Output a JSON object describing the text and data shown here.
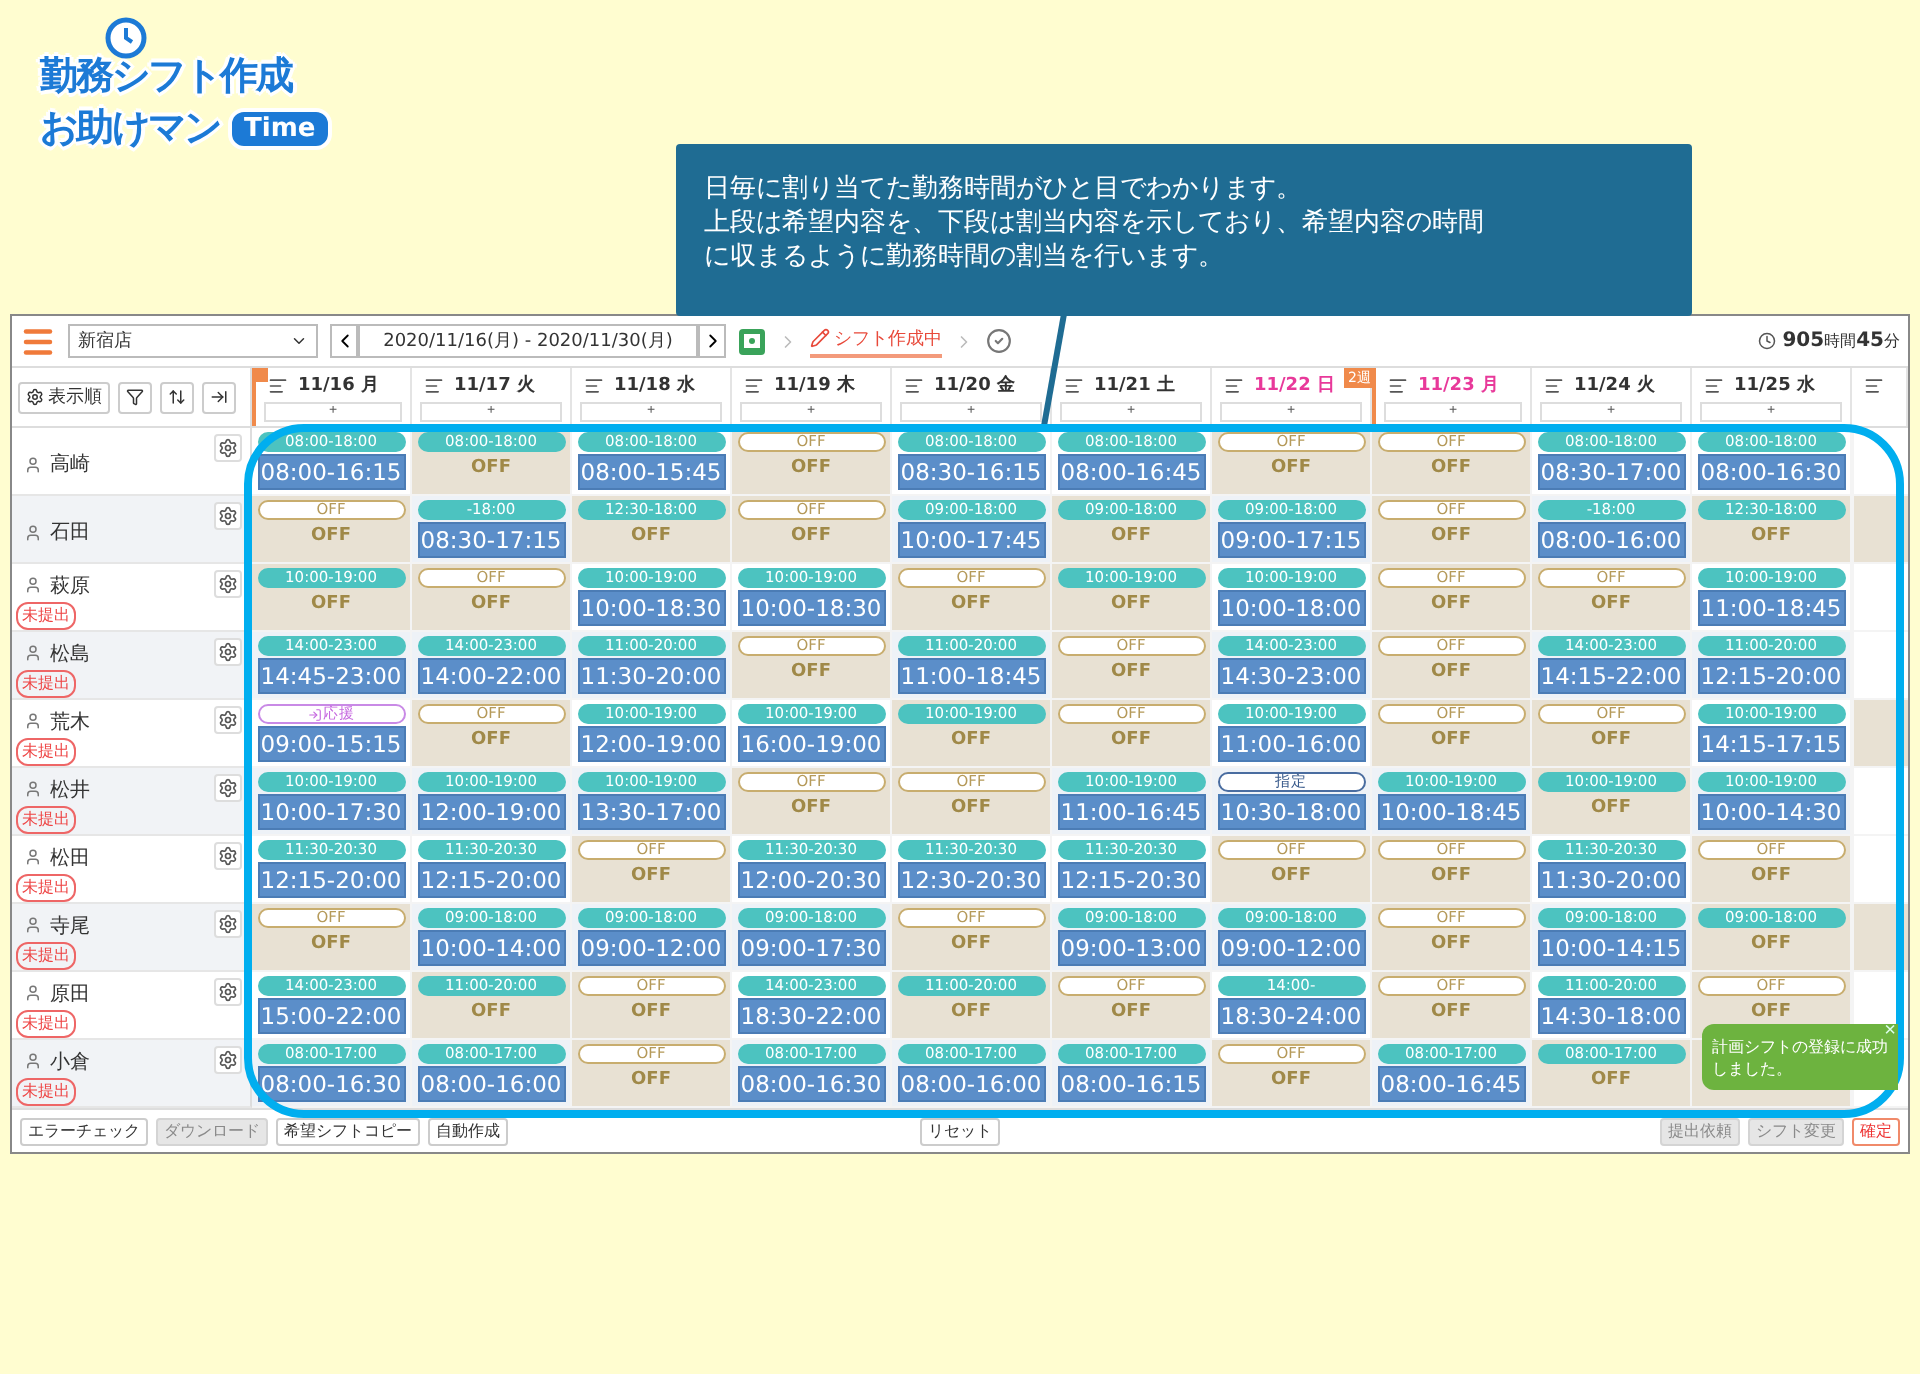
{
  "logo": {
    "line1": "勤務シフト作成",
    "line2": "お助けマン",
    "badge": "Time"
  },
  "callout": {
    "lines": [
      "日毎に割り当てた勤務時間がひと目でわかります。",
      "上段は希望内容を、下段は割当内容を示しており、希望内容の時間",
      "に収まるように勤務時間の割当を行います。"
    ]
  },
  "toolbar": {
    "store": "新宿店",
    "date_range": "2020/11/16(月) - 2020/11/30(月)",
    "status": "シフト作成中",
    "total": "**905**時間**45**分"
  },
  "header": {
    "sort_label": "表示順",
    "days": [
      {
        "label": "11/16 月",
        "holiday": false,
        "period_start": true,
        "add": "+"
      },
      {
        "label": "11/17 火",
        "holiday": false,
        "period_start": false,
        "add": "+"
      },
      {
        "label": "11/18 水",
        "holiday": false,
        "period_start": false,
        "add": "+"
      },
      {
        "label": "11/19 木",
        "holiday": false,
        "period_start": false,
        "add": "+"
      },
      {
        "label": "11/20 金",
        "holiday": false,
        "period_start": false,
        "add": "+"
      },
      {
        "label": "11/21 土",
        "holiday": false,
        "period_start": false,
        "add": "+"
      },
      {
        "label": "11/22 日",
        "holiday": true,
        "period_start": false,
        "add": "+"
      },
      {
        "label": "11/23 月",
        "holiday": true,
        "period_start": false,
        "week_label": "2週",
        "add": "+"
      },
      {
        "label": "11/24 火",
        "holiday": false,
        "period_start": false,
        "add": "+"
      },
      {
        "label": "11/25 水",
        "holiday": false,
        "period_start": false,
        "add": "+"
      }
    ]
  },
  "rows": [
    {
      "name": "高崎",
      "cells": [
        {
          "wish": {
            "kind": "time",
            "text": "08:00-18:00"
          },
          "shift": {
            "kind": "work",
            "text": "08:00-16:15"
          }
        },
        {
          "wish": {
            "kind": "time",
            "text": "08:00-18:00"
          },
          "shift": {
            "kind": "off",
            "text": "OFF"
          }
        },
        {
          "wish": {
            "kind": "time",
            "text": "08:00-18:00"
          },
          "shift": {
            "kind": "work",
            "text": "08:00-15:45"
          }
        },
        {
          "wish": {
            "kind": "off",
            "text": "OFF"
          },
          "shift": {
            "kind": "off",
            "text": "OFF"
          }
        },
        {
          "wish": {
            "kind": "time",
            "text": "08:00-18:00"
          },
          "shift": {
            "kind": "work",
            "text": "08:30-16:15"
          }
        },
        {
          "wish": {
            "kind": "time",
            "text": "08:00-18:00"
          },
          "shift": {
            "kind": "work",
            "text": "08:00-16:45"
          }
        },
        {
          "wish": {
            "kind": "off",
            "text": "OFF"
          },
          "shift": {
            "kind": "off",
            "text": "OFF"
          }
        },
        {
          "wish": {
            "kind": "off",
            "text": "OFF"
          },
          "shift": {
            "kind": "off",
            "text": "OFF"
          }
        },
        {
          "wish": {
            "kind": "time",
            "text": "08:00-18:00"
          },
          "shift": {
            "kind": "work",
            "text": "08:30-17:00"
          }
        },
        {
          "wish": {
            "kind": "time",
            "text": "08:00-18:00"
          },
          "shift": {
            "kind": "work",
            "text": "08:00-16:30"
          }
        }
      ]
    },
    {
      "name": "石田",
      "cells": [
        {
          "wish": {
            "kind": "off",
            "text": "OFF"
          },
          "shift": {
            "kind": "off",
            "text": "OFF"
          }
        },
        {
          "wish": {
            "kind": "time",
            "text": "-18:00"
          },
          "shift": {
            "kind": "work",
            "text": "08:30-17:15"
          }
        },
        {
          "wish": {
            "kind": "time",
            "text": "12:30-18:00"
          },
          "shift": {
            "kind": "off",
            "text": "OFF"
          }
        },
        {
          "wish": {
            "kind": "off",
            "text": "OFF"
          },
          "shift": {
            "kind": "off",
            "text": "OFF"
          }
        },
        {
          "wish": {
            "kind": "time",
            "text": "09:00-18:00"
          },
          "shift": {
            "kind": "work",
            "text": "10:00-17:45"
          }
        },
        {
          "wish": {
            "kind": "time",
            "text": "09:00-18:00"
          },
          "shift": {
            "kind": "off",
            "text": "OFF"
          }
        },
        {
          "wish": {
            "kind": "time",
            "text": "09:00-18:00"
          },
          "shift": {
            "kind": "work",
            "text": "09:00-17:15"
          }
        },
        {
          "wish": {
            "kind": "off",
            "text": "OFF"
          },
          "shift": {
            "kind": "off",
            "text": "OFF"
          }
        },
        {
          "wish": {
            "kind": "time",
            "text": "-18:00"
          },
          "shift": {
            "kind": "work",
            "text": "08:00-16:00"
          }
        },
        {
          "wish": {
            "kind": "time",
            "text": "12:30-18:00"
          },
          "shift": {
            "kind": "off",
            "text": "OFF"
          }
        }
      ]
    },
    {
      "name": "萩原",
      "badge": "未提出",
      "cells": [
        {
          "wish": {
            "kind": "time",
            "text": "10:00-19:00"
          },
          "shift": {
            "kind": "off",
            "text": "OFF"
          }
        },
        {
          "wish": {
            "kind": "off",
            "text": "OFF"
          },
          "shift": {
            "kind": "off",
            "text": "OFF"
          }
        },
        {
          "wish": {
            "kind": "time",
            "text": "10:00-19:00"
          },
          "shift": {
            "kind": "work",
            "text": "10:00-18:30"
          }
        },
        {
          "wish": {
            "kind": "time",
            "text": "10:00-19:00"
          },
          "shift": {
            "kind": "work",
            "text": "10:00-18:30"
          }
        },
        {
          "wish": {
            "kind": "off",
            "text": "OFF"
          },
          "shift": {
            "kind": "off",
            "text": "OFF"
          }
        },
        {
          "wish": {
            "kind": "time",
            "text": "10:00-19:00"
          },
          "shift": {
            "kind": "off",
            "text": "OFF"
          }
        },
        {
          "wish": {
            "kind": "time",
            "text": "10:00-19:00"
          },
          "shift": {
            "kind": "work",
            "text": "10:00-18:00"
          }
        },
        {
          "wish": {
            "kind": "off",
            "text": "OFF"
          },
          "shift": {
            "kind": "off",
            "text": "OFF"
          }
        },
        {
          "wish": {
            "kind": "off",
            "text": "OFF"
          },
          "shift": {
            "kind": "off",
            "text": "OFF"
          }
        },
        {
          "wish": {
            "kind": "time",
            "text": "10:00-19:00"
          },
          "shift": {
            "kind": "work",
            "text": "11:00-18:45"
          }
        }
      ]
    },
    {
      "name": "松島",
      "badge": "未提出",
      "cells": [
        {
          "wish": {
            "kind": "time",
            "text": "14:00-23:00"
          },
          "shift": {
            "kind": "work",
            "text": "14:45-23:00"
          }
        },
        {
          "wish": {
            "kind": "time",
            "text": "14:00-23:00"
          },
          "shift": {
            "kind": "work",
            "text": "14:00-22:00"
          }
        },
        {
          "wish": {
            "kind": "time",
            "text": "11:00-20:00"
          },
          "shift": {
            "kind": "work",
            "text": "11:30-20:00"
          }
        },
        {
          "wish": {
            "kind": "off",
            "text": "OFF"
          },
          "shift": {
            "kind": "off",
            "text": "OFF"
          }
        },
        {
          "wish": {
            "kind": "time",
            "text": "11:00-20:00"
          },
          "shift": {
            "kind": "work",
            "text": "11:00-18:45"
          }
        },
        {
          "wish": {
            "kind": "off",
            "text": "OFF"
          },
          "shift": {
            "kind": "off",
            "text": "OFF"
          }
        },
        {
          "wish": {
            "kind": "time",
            "text": "14:00-23:00"
          },
          "shift": {
            "kind": "work",
            "text": "14:30-23:00"
          }
        },
        {
          "wish": {
            "kind": "off",
            "text": "OFF"
          },
          "shift": {
            "kind": "off",
            "text": "OFF"
          }
        },
        {
          "wish": {
            "kind": "time",
            "text": "14:00-23:00"
          },
          "shift": {
            "kind": "work",
            "text": "14:15-22:00"
          }
        },
        {
          "wish": {
            "kind": "time",
            "text": "11:00-20:00"
          },
          "shift": {
            "kind": "work",
            "text": "12:15-20:00"
          }
        }
      ]
    },
    {
      "name": "荒木",
      "badge": "未提出",
      "cells": [
        {
          "wish": {
            "kind": "support",
            "text": "応援"
          },
          "shift": {
            "kind": "work",
            "text": "09:00-15:15"
          }
        },
        {
          "wish": {
            "kind": "off",
            "text": "OFF"
          },
          "shift": {
            "kind": "off",
            "text": "OFF"
          }
        },
        {
          "wish": {
            "kind": "time",
            "text": "10:00-19:00"
          },
          "shift": {
            "kind": "work",
            "text": "12:00-19:00"
          }
        },
        {
          "wish": {
            "kind": "time",
            "text": "10:00-19:00"
          },
          "shift": {
            "kind": "work",
            "text": "16:00-19:00"
          }
        },
        {
          "wish": {
            "kind": "time",
            "text": "10:00-19:00"
          },
          "shift": {
            "kind": "off",
            "text": "OFF"
          }
        },
        {
          "wish": {
            "kind": "off",
            "text": "OFF"
          },
          "shift": {
            "kind": "off",
            "text": "OFF"
          }
        },
        {
          "wish": {
            "kind": "time",
            "text": "10:00-19:00"
          },
          "shift": {
            "kind": "work",
            "text": "11:00-16:00"
          }
        },
        {
          "wish": {
            "kind": "off",
            "text": "OFF"
          },
          "shift": {
            "kind": "off",
            "text": "OFF"
          }
        },
        {
          "wish": {
            "kind": "off",
            "text": "OFF"
          },
          "shift": {
            "kind": "off",
            "text": "OFF"
          }
        },
        {
          "wish": {
            "kind": "time",
            "text": "10:00-19:00"
          },
          "shift": {
            "kind": "work",
            "text": "14:15-17:15"
          }
        }
      ]
    },
    {
      "name": "松井",
      "badge": "未提出",
      "cells": [
        {
          "wish": {
            "kind": "time",
            "text": "10:00-19:00"
          },
          "shift": {
            "kind": "work",
            "text": "10:00-17:30"
          }
        },
        {
          "wish": {
            "kind": "time",
            "text": "10:00-19:00"
          },
          "shift": {
            "kind": "work",
            "text": "12:00-19:00"
          }
        },
        {
          "wish": {
            "kind": "time",
            "text": "10:00-19:00"
          },
          "shift": {
            "kind": "work",
            "text": "13:30-17:00"
          }
        },
        {
          "wish": {
            "kind": "off",
            "text": "OFF"
          },
          "shift": {
            "kind": "off",
            "text": "OFF"
          }
        },
        {
          "wish": {
            "kind": "off",
            "text": "OFF"
          },
          "shift": {
            "kind": "off",
            "text": "OFF"
          }
        },
        {
          "wish": {
            "kind": "time",
            "text": "10:00-19:00"
          },
          "shift": {
            "kind": "work",
            "text": "11:00-16:45"
          }
        },
        {
          "wish": {
            "kind": "fixed",
            "text": "指定"
          },
          "shift": {
            "kind": "work",
            "text": "10:30-18:00"
          }
        },
        {
          "wish": {
            "kind": "time",
            "text": "10:00-19:00"
          },
          "shift": {
            "kind": "work",
            "text": "10:00-18:45"
          }
        },
        {
          "wish": {
            "kind": "time",
            "text": "10:00-19:00"
          },
          "shift": {
            "kind": "off",
            "text": "OFF"
          }
        },
        {
          "wish": {
            "kind": "time",
            "text": "10:00-19:00"
          },
          "shift": {
            "kind": "work",
            "text": "10:00-14:30"
          }
        }
      ]
    },
    {
      "name": "松田",
      "badge": "未提出",
      "cells": [
        {
          "wish": {
            "kind": "time",
            "text": "11:30-20:30"
          },
          "shift": {
            "kind": "work",
            "text": "12:15-20:00"
          }
        },
        {
          "wish": {
            "kind": "time",
            "text": "11:30-20:30"
          },
          "shift": {
            "kind": "work",
            "text": "12:15-20:00"
          }
        },
        {
          "wish": {
            "kind": "off",
            "text": "OFF"
          },
          "shift": {
            "kind": "off",
            "text": "OFF"
          }
        },
        {
          "wish": {
            "kind": "time",
            "text": "11:30-20:30"
          },
          "shift": {
            "kind": "work",
            "text": "12:00-20:30"
          }
        },
        {
          "wish": {
            "kind": "time",
            "text": "11:30-20:30"
          },
          "shift": {
            "kind": "work",
            "text": "12:30-20:30"
          }
        },
        {
          "wish": {
            "kind": "time",
            "text": "11:30-20:30"
          },
          "shift": {
            "kind": "work",
            "text": "12:15-20:30"
          }
        },
        {
          "wish": {
            "kind": "off",
            "text": "OFF"
          },
          "shift": {
            "kind": "off",
            "text": "OFF"
          }
        },
        {
          "wish": {
            "kind": "off",
            "text": "OFF"
          },
          "shift": {
            "kind": "off",
            "text": "OFF"
          }
        },
        {
          "wish": {
            "kind": "time",
            "text": "11:30-20:30"
          },
          "shift": {
            "kind": "work",
            "text": "11:30-20:00"
          }
        },
        {
          "wish": {
            "kind": "off",
            "text": "OFF"
          },
          "shift": {
            "kind": "off",
            "text": "OFF"
          }
        }
      ]
    },
    {
      "name": "寺尾",
      "badge": "未提出",
      "cells": [
        {
          "wish": {
            "kind": "off",
            "text": "OFF"
          },
          "shift": {
            "kind": "off",
            "text": "OFF"
          }
        },
        {
          "wish": {
            "kind": "time",
            "text": "09:00-18:00"
          },
          "shift": {
            "kind": "work",
            "text": "10:00-14:00"
          }
        },
        {
          "wish": {
            "kind": "time",
            "text": "09:00-18:00"
          },
          "shift": {
            "kind": "work",
            "text": "09:00-12:00"
          }
        },
        {
          "wish": {
            "kind": "time",
            "text": "09:00-18:00"
          },
          "shift": {
            "kind": "work",
            "text": "09:00-17:30"
          }
        },
        {
          "wish": {
            "kind": "off",
            "text": "OFF"
          },
          "shift": {
            "kind": "off",
            "text": "OFF"
          }
        },
        {
          "wish": {
            "kind": "time",
            "text": "09:00-18:00"
          },
          "shift": {
            "kind": "work",
            "text": "09:00-13:00"
          }
        },
        {
          "wish": {
            "kind": "time",
            "text": "09:00-18:00"
          },
          "shift": {
            "kind": "work",
            "text": "09:00-12:00"
          }
        },
        {
          "wish": {
            "kind": "off",
            "text": "OFF"
          },
          "shift": {
            "kind": "off",
            "text": "OFF"
          }
        },
        {
          "wish": {
            "kind": "time",
            "text": "09:00-18:00"
          },
          "shift": {
            "kind": "work",
            "text": "10:00-14:15"
          }
        },
        {
          "wish": {
            "kind": "time",
            "text": "09:00-18:00"
          },
          "shift": {
            "kind": "off",
            "text": "OFF"
          }
        }
      ]
    },
    {
      "name": "原田",
      "badge": "未提出",
      "cells": [
        {
          "wish": {
            "kind": "time",
            "text": "14:00-23:00"
          },
          "shift": {
            "kind": "work",
            "text": "15:00-22:00"
          }
        },
        {
          "wish": {
            "kind": "time",
            "text": "11:00-20:00"
          },
          "shift": {
            "kind": "off",
            "text": "OFF"
          }
        },
        {
          "wish": {
            "kind": "off",
            "text": "OFF"
          },
          "shift": {
            "kind": "off",
            "text": "OFF"
          }
        },
        {
          "wish": {
            "kind": "time",
            "text": "14:00-23:00"
          },
          "shift": {
            "kind": "work",
            "text": "18:30-22:00"
          }
        },
        {
          "wish": {
            "kind": "time",
            "text": "11:00-20:00"
          },
          "shift": {
            "kind": "off",
            "text": "OFF"
          }
        },
        {
          "wish": {
            "kind": "off",
            "text": "OFF"
          },
          "shift": {
            "kind": "off",
            "text": "OFF"
          }
        },
        {
          "wish": {
            "kind": "time",
            "text": "14:00-"
          },
          "shift": {
            "kind": "work",
            "text": "18:30-24:00"
          }
        },
        {
          "wish": {
            "kind": "off",
            "text": "OFF"
          },
          "shift": {
            "kind": "off",
            "text": "OFF"
          }
        },
        {
          "wish": {
            "kind": "time",
            "text": "11:00-20:00"
          },
          "shift": {
            "kind": "work",
            "text": "14:30-18:00"
          }
        },
        {
          "wish": {
            "kind": "off",
            "text": "OFF"
          },
          "shift": {
            "kind": "off",
            "text": "OFF"
          }
        }
      ]
    },
    {
      "name": "小倉",
      "badge": "未提出",
      "cells": [
        {
          "wish": {
            "kind": "time",
            "text": "08:00-17:00"
          },
          "shift": {
            "kind": "work",
            "text": "08:00-16:30"
          }
        },
        {
          "wish": {
            "kind": "time",
            "text": "08:00-17:00"
          },
          "shift": {
            "kind": "work",
            "text": "08:00-16:00"
          }
        },
        {
          "wish": {
            "kind": "off",
            "text": "OFF"
          },
          "shift": {
            "kind": "off",
            "text": "OFF"
          }
        },
        {
          "wish": {
            "kind": "time",
            "text": "08:00-17:00"
          },
          "shift": {
            "kind": "work",
            "text": "08:00-16:30"
          }
        },
        {
          "wish": {
            "kind": "time",
            "text": "08:00-17:00"
          },
          "shift": {
            "kind": "work",
            "text": "08:00-16:00"
          }
        },
        {
          "wish": {
            "kind": "time",
            "text": "08:00-17:00"
          },
          "shift": {
            "kind": "work",
            "text": "08:00-16:15"
          }
        },
        {
          "wish": {
            "kind": "off",
            "text": "OFF"
          },
          "shift": {
            "kind": "off",
            "text": "OFF"
          }
        },
        {
          "wish": {
            "kind": "time",
            "text": "08:00-17:00"
          },
          "shift": {
            "kind": "work",
            "text": "08:00-16:45"
          }
        },
        {
          "wish": {
            "kind": "time",
            "text": "08:00-17:00"
          },
          "shift": {
            "kind": "off",
            "text": "OFF"
          }
        }
      ]
    }
  ],
  "footer": {
    "left": [
      {
        "label": "エラーチェック",
        "kind": "normal"
      },
      {
        "label": "ダウンロード",
        "kind": "disabled"
      },
      {
        "label": "希望シフトコピー",
        "kind": "normal"
      },
      {
        "label": "自動作成",
        "kind": "normal"
      }
    ],
    "center": [
      {
        "label": "リセット",
        "kind": "normal"
      }
    ],
    "right": [
      {
        "label": "提出依頼",
        "kind": "disabled"
      },
      {
        "label": "シフト変更",
        "kind": "disabled"
      },
      {
        "label": "確定",
        "kind": "confirm"
      }
    ]
  },
  "toast": {
    "message": "計画シフトの登録に成功しました。",
    "close": "×"
  }
}
